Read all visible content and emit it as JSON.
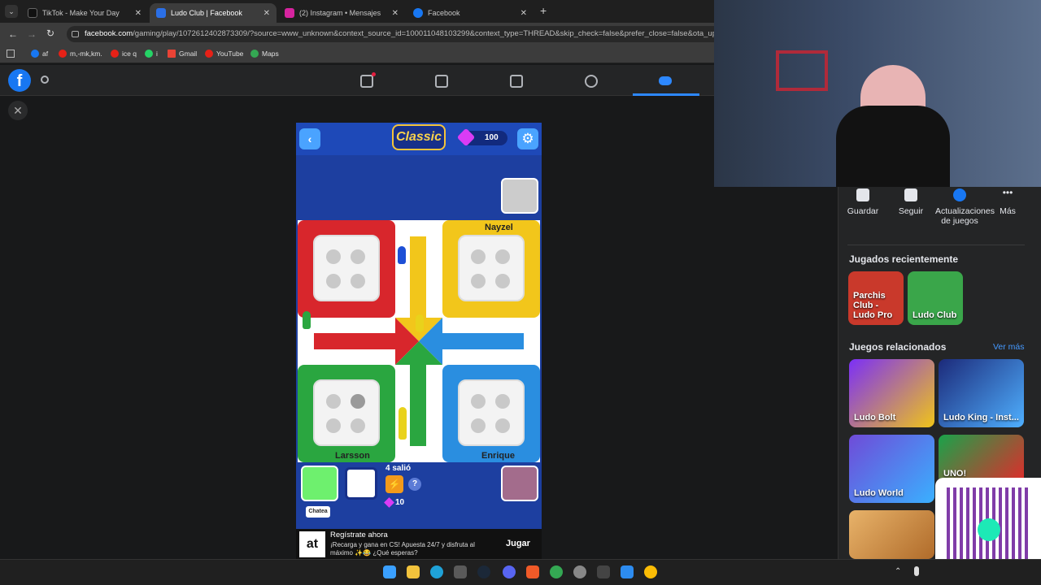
{
  "tabs": [
    {
      "label": "TikTok - Make Your Day",
      "color": "#111111"
    },
    {
      "label": "Ludo Club | Facebook",
      "color": "#2b6fe6"
    },
    {
      "label": "(2) Instagram • Mensajes",
      "color": "#d6249f"
    },
    {
      "label": "Facebook",
      "color": "#1877f2"
    }
  ],
  "address": {
    "domain": "facebook.com",
    "path": "/gaming/play/1072612402873309/?source=www_unknown&context_source_id=100011048103299&context_type=THREAD&skip_check=false&prefer_close=false&ota_update"
  },
  "bookmarks": [
    "af",
    "m,-mk,km.",
    "ice q",
    "i",
    "Gmail",
    "YouTube",
    "Maps"
  ],
  "game": {
    "header_logo": "Classic",
    "gems": "100",
    "players": {
      "top_right": "Nayzel",
      "bottom_left": "Larsson",
      "bottom_right": "Enrique"
    },
    "roll_text": "4 salió",
    "score": "10",
    "chat_label": "Chatea",
    "help_icon": "?"
  },
  "ad": {
    "title": "Regístrate ahora",
    "body": "¡Recarga y gana en CS! Apuesta 24/7 y disfruta al máximo ✨😂 ¿Qué esperas?",
    "button": "Jugar",
    "logo": "at"
  },
  "actions": [
    "Guardar",
    "Seguir",
    "Actualizaciones de juegos",
    "Más"
  ],
  "sections": {
    "recent": "Jugados recientemente",
    "related": "Juegos relacionados",
    "see_more": "Ver más"
  },
  "recent_games": [
    "Parchis Club - Ludo Pro",
    "Ludo Club"
  ],
  "related_games": [
    "Ludo Bolt",
    "Ludo King - Inst...",
    "Ludo World",
    "UNO!"
  ],
  "colors": {
    "red": "#d8262c",
    "yellow": "#f2c61b",
    "green": "#2aa640",
    "blue": "#2a8ee0",
    "fb_blue": "#1877f2"
  }
}
